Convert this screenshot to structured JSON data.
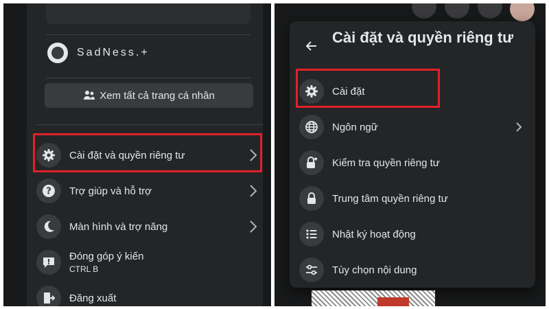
{
  "left": {
    "profile_name": "SadNess.+",
    "see_all_label": "Xem tất cả trang cá nhân",
    "items": [
      {
        "label": "Cài đặt và quyền riêng tư",
        "icon": "gear-icon"
      },
      {
        "label": "Trợ giúp và hỗ trợ",
        "icon": "question-icon"
      },
      {
        "label": "Màn hình và trợ năng",
        "icon": "moon-icon"
      },
      {
        "label": "Đóng góp ý kiến",
        "sub": "CTRL B",
        "icon": "feedback-icon"
      },
      {
        "label": "Đăng xuất",
        "icon": "logout-icon"
      }
    ]
  },
  "right": {
    "title": "Cài đặt và quyền riêng tư",
    "items": [
      {
        "label": "Cài đặt",
        "icon": "gear-icon"
      },
      {
        "label": "Ngôn ngữ",
        "icon": "globe-icon"
      },
      {
        "label": "Kiểm tra quyền riêng tư",
        "icon": "lock-heart-icon"
      },
      {
        "label": "Trung tâm quyền riêng tư",
        "icon": "lock-icon"
      },
      {
        "label": "Nhật ký hoạt động",
        "icon": "list-icon"
      },
      {
        "label": "Tùy chọn nội dung",
        "icon": "sliders-icon"
      }
    ]
  },
  "colors": {
    "background": "#18191a",
    "card": "#242526",
    "button": "#3a3b3c",
    "text": "#e4e6eb",
    "highlight": "#e0212b"
  }
}
